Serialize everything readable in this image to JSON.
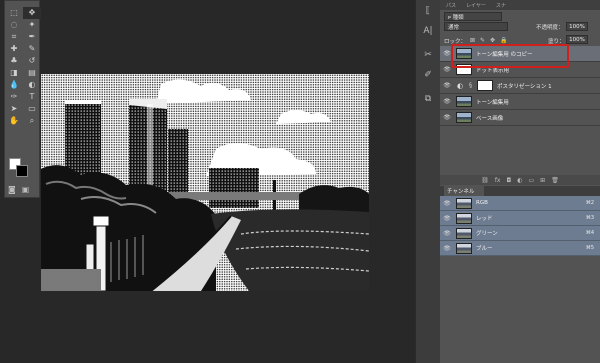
{
  "tools": {
    "icons": [
      "marquee-icon",
      "move-icon",
      "lasso-icon",
      "magic-wand-icon",
      "crop-icon",
      "eyedropper-icon",
      "healing-brush-icon",
      "brush-icon",
      "stamp-icon",
      "history-brush-icon",
      "eraser-icon",
      "gradient-icon",
      "blur-icon",
      "dodge-icon",
      "pen-icon",
      "type-icon",
      "path-select-icon",
      "shape-icon",
      "hand-icon",
      "zoom-icon"
    ],
    "glyphs": [
      "⬚",
      "✥",
      "◌",
      "✦",
      "⌗",
      "✒",
      "✚",
      "✎",
      "♣",
      "↺",
      "◨",
      "▤",
      "💧",
      "◐",
      "✑",
      "T",
      "➤",
      "▭",
      "✋",
      "⌕"
    ]
  },
  "panel": {
    "tabs": [
      "パス",
      "レイヤー",
      "スナ"
    ],
    "kind_filter": "ᴘ 種類",
    "blend_mode": "通常",
    "opacity_label": "不透明度：",
    "opacity_value": "100%",
    "lock_label": "ロック：",
    "fill_label": "塗り：",
    "fill_value": "100%"
  },
  "layers": [
    {
      "name": "トーン編集用 のコピー",
      "type": "photo",
      "active": true
    },
    {
      "name": "ドット表示用",
      "type": "white",
      "active": false
    },
    {
      "name": "ポスタリゼーション 1",
      "type": "adjustment",
      "active": false
    },
    {
      "name": "トーン編集用",
      "type": "photo",
      "active": false
    },
    {
      "name": "ベース画像",
      "type": "photo",
      "active": false
    }
  ],
  "channels": {
    "tab": "チャンネル",
    "items": [
      {
        "name": "RGB",
        "shortcut": "⌘2"
      },
      {
        "name": "レッド",
        "shortcut": "⌘3"
      },
      {
        "name": "グリーン",
        "shortcut": "⌘4"
      },
      {
        "name": "ブルー",
        "shortcut": "⌘5"
      }
    ]
  },
  "colors": {
    "highlight_border": "#d0201d",
    "channel_selected": "#6e7c91",
    "layer_selected": "#6a6e76"
  }
}
